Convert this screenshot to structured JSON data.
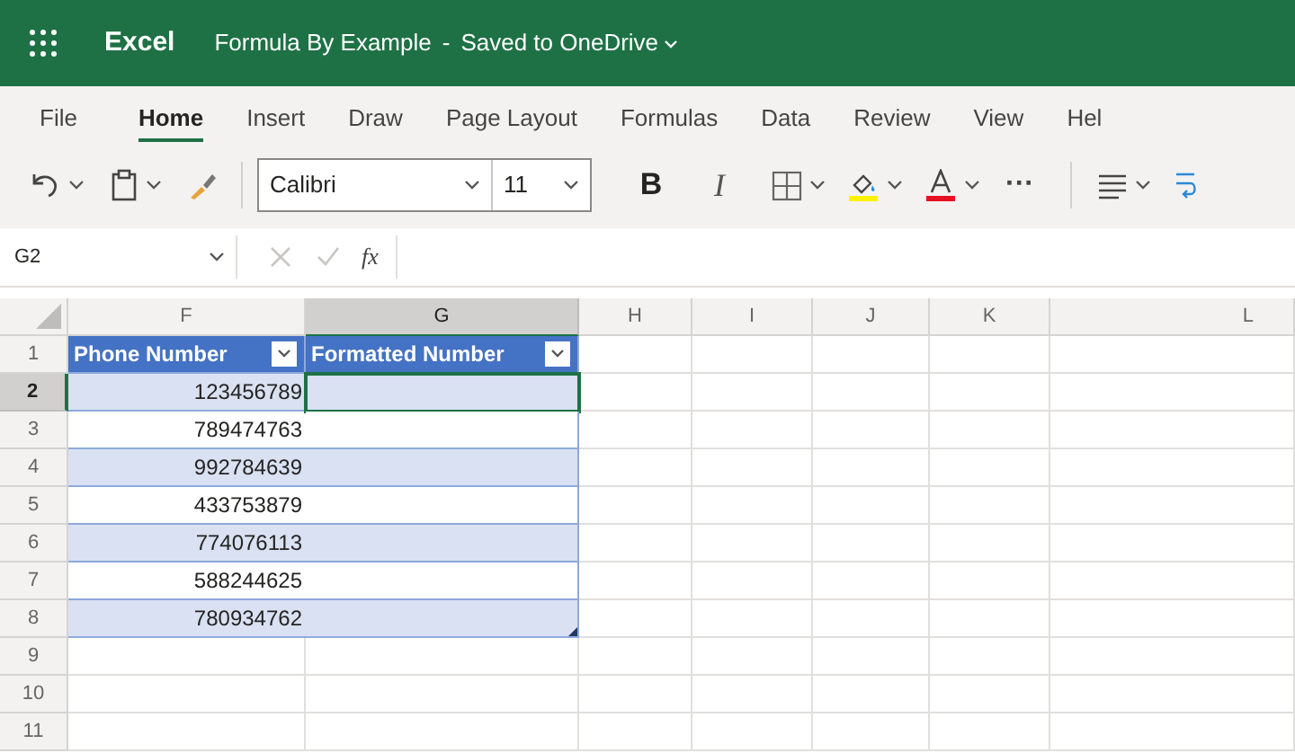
{
  "title_bar": {
    "app": "Excel",
    "document": "Formula By Example",
    "separator": "-",
    "save_status": "Saved to OneDrive"
  },
  "ribbon_tabs": [
    {
      "label": "File",
      "selected": false
    },
    {
      "label": "Home",
      "selected": true
    },
    {
      "label": "Insert",
      "selected": false
    },
    {
      "label": "Draw",
      "selected": false
    },
    {
      "label": "Page Layout",
      "selected": false
    },
    {
      "label": "Formulas",
      "selected": false
    },
    {
      "label": "Data",
      "selected": false
    },
    {
      "label": "Review",
      "selected": false
    },
    {
      "label": "View",
      "selected": false
    },
    {
      "label": "Hel",
      "selected": false
    }
  ],
  "toolbar": {
    "font": "Calibri",
    "font_size": "11",
    "bold": "B",
    "italic": "I",
    "more": "···"
  },
  "formula_bar": {
    "name_box": "G2",
    "function_label": "fx"
  },
  "columns": [
    {
      "label": "F",
      "selected": false
    },
    {
      "label": "G",
      "selected": true
    },
    {
      "label": "H",
      "selected": false
    },
    {
      "label": "I",
      "selected": false
    },
    {
      "label": "J",
      "selected": false
    },
    {
      "label": "K",
      "selected": false
    },
    {
      "label": "L",
      "selected": false
    }
  ],
  "row_headers": [
    {
      "label": "1",
      "selected": false
    },
    {
      "label": "2",
      "selected": true
    },
    {
      "label": "3",
      "selected": false
    },
    {
      "label": "4",
      "selected": false
    },
    {
      "label": "5",
      "selected": false
    },
    {
      "label": "6",
      "selected": false
    },
    {
      "label": "7",
      "selected": false
    },
    {
      "label": "8",
      "selected": false
    },
    {
      "label": "9",
      "selected": false
    },
    {
      "label": "10",
      "selected": false
    },
    {
      "label": "11",
      "selected": false
    }
  ],
  "table": {
    "headers": [
      "Phone Number",
      "Formatted Number"
    ],
    "rows": [
      {
        "phone": "123456789",
        "selected": true
      },
      {
        "phone": "789474763",
        "selected": false
      },
      {
        "phone": "992784639",
        "selected": false
      },
      {
        "phone": "433753879",
        "selected": false
      },
      {
        "phone": "774076113",
        "selected": false
      },
      {
        "phone": "588244625",
        "selected": false
      },
      {
        "phone": "780934762",
        "selected": false
      }
    ]
  }
}
